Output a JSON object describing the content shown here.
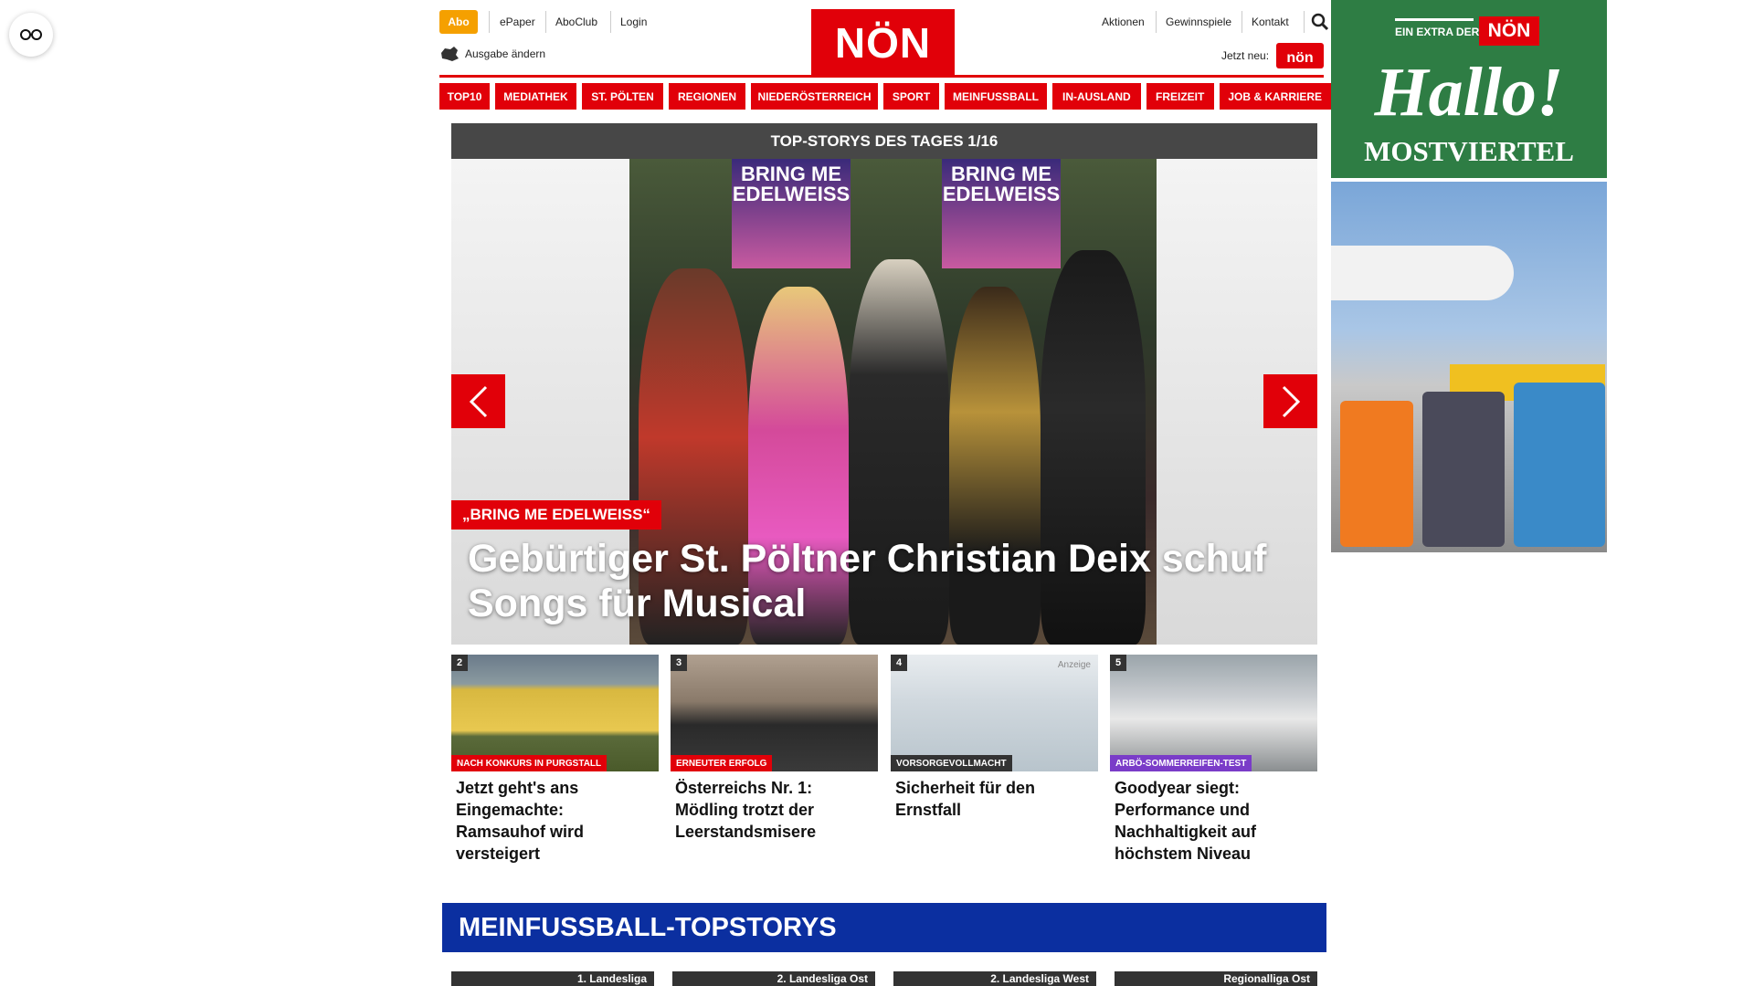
{
  "header": {
    "abo": "Abo",
    "links_left": [
      "ePaper",
      "AboClub",
      "Login"
    ],
    "edition": "Ausgabe ändern",
    "logo": "NÖN",
    "links_right": [
      "Aktionen",
      "Gewinnspiele",
      "Kontakt"
    ],
    "jetzt_neu": "Jetzt neu:",
    "jetzt_badge": "nön"
  },
  "nav": [
    "TOP10",
    "MEDIATHEK",
    "ST. PÖLTEN",
    "REGIONEN",
    "NIEDERÖSTERREICH",
    "SPORT",
    "MEINFUSSBALL",
    "IN-AUSLAND",
    "FREIZEIT",
    "JOB & KARRIERE"
  ],
  "hero": {
    "bar_title": "TOP-STORYS DES TAGES 1/16",
    "poster_text": "BRING ME EDELWEISS",
    "kicker": "„BRING ME EDELWEISS“",
    "title": "Gebürtiger St. Pöltner Christian Deix schuf Songs für Musical"
  },
  "cards": [
    {
      "num": "2",
      "tag": "NACH KONKURS IN PURGSTALL",
      "tag_color": "#e10009",
      "title": "Jetzt geht's ans Eingemachte: Ramsauhof wird versteigert",
      "badge": ""
    },
    {
      "num": "3",
      "tag": "ERNEUTER ERFOLG",
      "tag_color": "#e10009",
      "title": "Österreichs Nr. 1: Mödling trotzt der Leerstandsmisere",
      "badge": ""
    },
    {
      "num": "4",
      "tag": "VORSORGEVOLLMACHT",
      "tag_color": "#333333",
      "title": "Sicherheit für den Ernstfall",
      "badge": "Anzeige"
    },
    {
      "num": "5",
      "tag": "ARBÖ-SOMMERREIFEN-TEST",
      "tag_color": "#7a3cc8",
      "title": "Goodyear siegt: Performance und Nachhaltigkeit auf höchstem Niveau",
      "badge": ""
    }
  ],
  "meinfussball": {
    "title": "MEINFUSSBALL-TOPSTORYS",
    "leagues": [
      "1. Landesliga",
      "2. Landesliga Ost",
      "2. Landesliga West",
      "Regionalliga Ost"
    ]
  },
  "ad": {
    "extra": "EIN EXTRA DER",
    "logo": "NÖN",
    "hallo": "Hallo!",
    "region": "MOSTVIERTEL"
  }
}
